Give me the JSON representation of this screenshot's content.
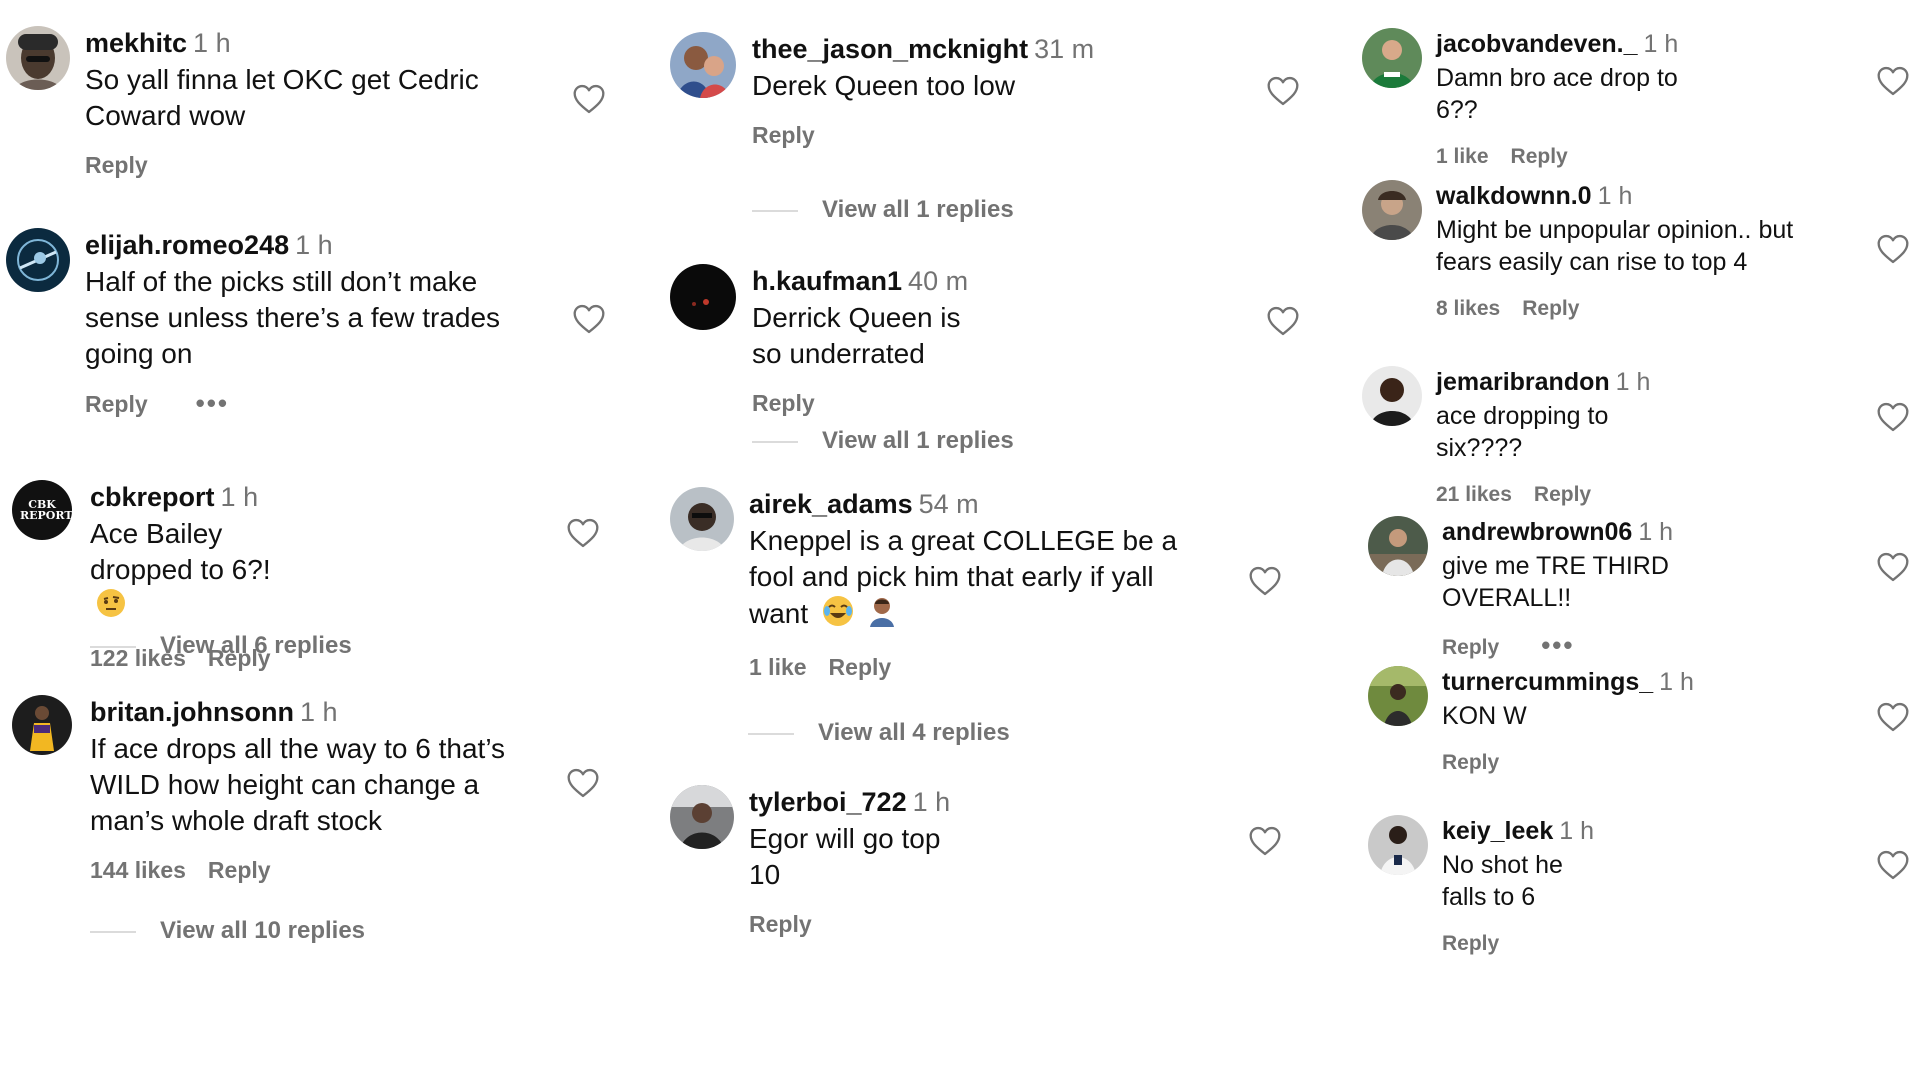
{
  "comments": {
    "c1": {
      "username": "mekhitc",
      "time": "1 h",
      "text": "So yall finna let OKC get Cedric Coward wow",
      "reply": "Reply"
    },
    "c2": {
      "username": "elijah.romeo248",
      "time": "1 h",
      "text": "Half of the picks still don’t make sense unless there’s a few trades going on",
      "reply": "Reply",
      "more": "•••"
    },
    "c3": {
      "username": "cbkreport",
      "time": "1 h",
      "text": "Ace Bailey dropped to 6?!",
      "likes": "122 likes",
      "reply": "Reply",
      "view_all": "View all 6 replies",
      "avatar_text": "CBK REPORT"
    },
    "c4": {
      "username": "britan.johnsonn",
      "time": "1 h",
      "text": "If ace drops all the way to 6 that’s WILD how height can change a man’s whole draft stock",
      "likes": "144 likes",
      "reply": "Reply",
      "view_all": "View all 10 replies"
    },
    "c5": {
      "username": "thee_jason_mcknight",
      "time": "31 m",
      "text": "Derek Queen too low",
      "reply": "Reply",
      "view_all": "View all 1 replies"
    },
    "c6": {
      "username": "h.kaufman1",
      "time": "40 m",
      "text": "Derrick Queen is so underrated",
      "reply": "Reply",
      "view_all": "View all 1 replies"
    },
    "c7": {
      "username": "airek_adams",
      "time": "54 m",
      "text": "Kneppel is a great COLLEGE be a fool and pick him that early if yall want",
      "likes": "1 like",
      "reply": "Reply",
      "view_all": "View all 4 replies"
    },
    "c8": {
      "username": "tylerboi_722",
      "time": "1 h",
      "text": "Egor will go top 10",
      "reply": "Reply"
    },
    "c9": {
      "username": "jacobvandeven._",
      "time": "1 h",
      "text": "Damn bro ace drop to 6??",
      "likes": "1 like",
      "reply": "Reply"
    },
    "c10": {
      "username": "walkdownn.0",
      "time": "1 h",
      "text": "Might be unpopular opinion.. but fears easily can rise to top 4",
      "likes": "8 likes",
      "reply": "Reply"
    },
    "c11": {
      "username": "jemaribrandon",
      "time": "1 h",
      "text": "ace dropping to six????",
      "likes": "21 likes",
      "reply": "Reply"
    },
    "c12": {
      "username": "andrewbrown06",
      "time": "1 h",
      "text": "give me TRE THIRD OVERALL!!",
      "reply": "Reply",
      "more": "•••"
    },
    "c13": {
      "username": "turnercummings_",
      "time": "1 h",
      "text": "KON W",
      "reply": "Reply"
    },
    "c14": {
      "username": "keiy_leek",
      "time": "1 h",
      "text": "No shot he falls to 6",
      "reply": "Reply"
    }
  },
  "icons": {
    "heart": "heart-outline-icon",
    "emoji": "emoji-icon"
  },
  "colors": {
    "meta_gray": "#737373",
    "divider": "#dbdbdb"
  }
}
